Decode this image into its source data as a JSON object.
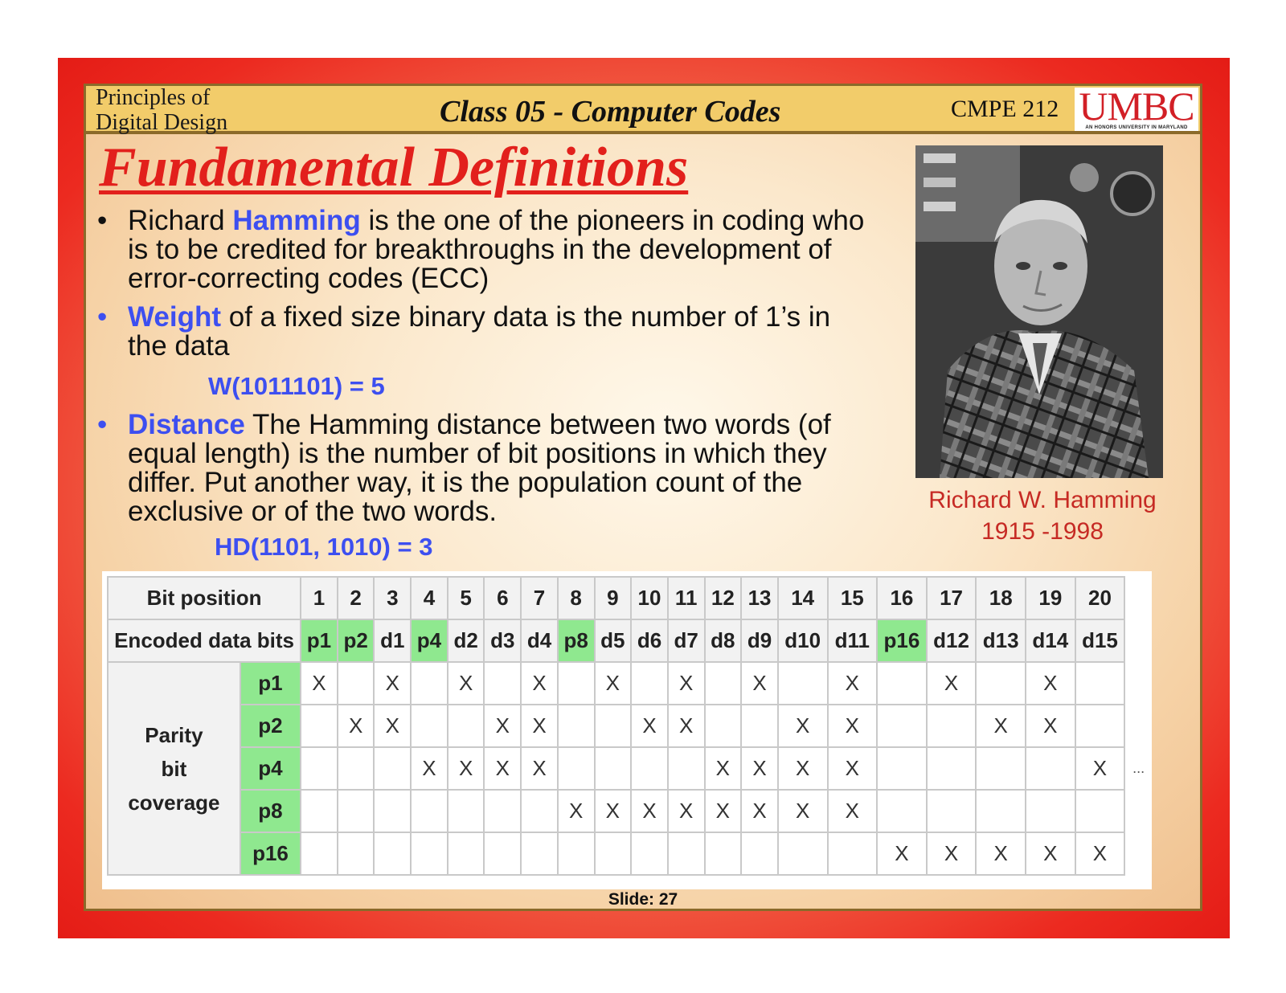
{
  "header": {
    "course_line1": "Principles of",
    "course_line2": "Digital Design",
    "class_title": "Class 05 - Computer Codes",
    "course_code": "CMPE 212",
    "logo_text": "UMBC",
    "logo_tagline": "AN HONORS UNIVERSITY IN MARYLAND"
  },
  "slide_title": "Fundamental Definitions",
  "bullets": {
    "b1": {
      "dot": "•",
      "pre": "Richard ",
      "kw": "Hamming",
      "post": " is the one of the pioneers in coding who is to be credited for breakthroughs in the development of error-correcting codes (ECC)"
    },
    "b2": {
      "dot": "•",
      "kw": "Weight",
      "post": " of a fixed size binary data is the number of 1’s in the data",
      "formula": "W(1011101) = 5"
    },
    "b3": {
      "dot": "•",
      "kw": "Distance",
      "post": " The Hamming distance between two words (of equal length) is the number of bit positions in which they differ. Put another way, it is the population count of the exclusive or of the two words.",
      "formula": "HD(1101, 1010) = 3"
    }
  },
  "photo_caption": {
    "name": "Richard W. Hamming",
    "years": "1915 -1998"
  },
  "table": {
    "bit_position_label": "Bit position",
    "encoded_label": "Encoded data bits",
    "coverage_label_1": "Parity",
    "coverage_label_2": "bit",
    "coverage_label_3": "coverage",
    "ellipsis": "...",
    "positions": [
      "1",
      "2",
      "3",
      "4",
      "5",
      "6",
      "7",
      "8",
      "9",
      "10",
      "11",
      "12",
      "13",
      "14",
      "15",
      "16",
      "17",
      "18",
      "19",
      "20"
    ],
    "encoded": [
      "p1",
      "p2",
      "d1",
      "p4",
      "d2",
      "d3",
      "d4",
      "p8",
      "d5",
      "d6",
      "d7",
      "d8",
      "d9",
      "d10",
      "d11",
      "p16",
      "d12",
      "d13",
      "d14",
      "d15"
    ],
    "parity_columns": [
      1,
      2,
      4,
      8,
      16
    ],
    "mark": "X",
    "rows": [
      {
        "label": "p1",
        "covered": [
          1,
          3,
          5,
          7,
          9,
          11,
          13,
          15,
          17,
          19
        ]
      },
      {
        "label": "p2",
        "covered": [
          2,
          3,
          6,
          7,
          10,
          11,
          14,
          15,
          18,
          19
        ]
      },
      {
        "label": "p4",
        "covered": [
          4,
          5,
          6,
          7,
          12,
          13,
          14,
          15,
          20
        ]
      },
      {
        "label": "p8",
        "covered": [
          8,
          9,
          10,
          11,
          12,
          13,
          14,
          15
        ]
      },
      {
        "label": "p16",
        "covered": [
          16,
          17,
          18,
          19,
          20
        ]
      }
    ]
  },
  "footer": {
    "slide_number": "Slide: 27"
  }
}
